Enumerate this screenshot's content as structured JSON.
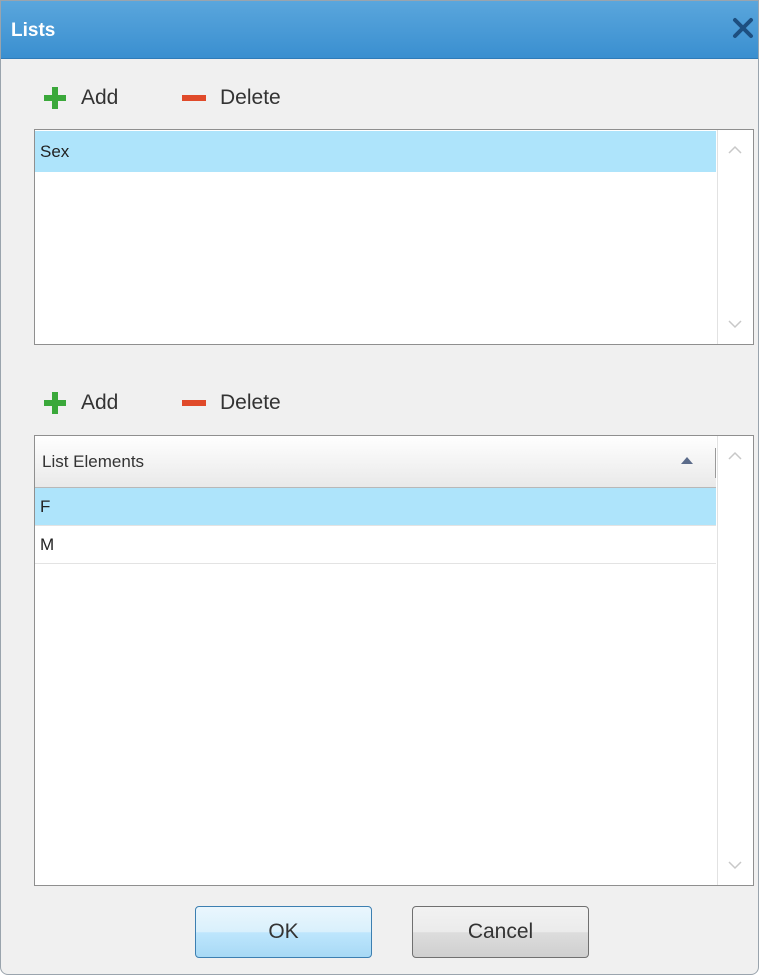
{
  "dialog": {
    "title": "Lists"
  },
  "lists_toolbar": {
    "add_label": "Add",
    "delete_label": "Delete"
  },
  "lists": {
    "items": [
      "Sex"
    ],
    "selected_index": 0
  },
  "elements_toolbar": {
    "add_label": "Add",
    "delete_label": "Delete"
  },
  "elements": {
    "column_header": "List Elements",
    "sort": "ascending",
    "rows": [
      "F",
      "M"
    ],
    "selected_index": 0
  },
  "buttons": {
    "ok_label": "OK",
    "cancel_label": "Cancel"
  },
  "colors": {
    "titlebar": "#3a8fd0",
    "selection": "#aee4fb",
    "add_icon": "#3aa83a",
    "delete_icon": "#e04a2a"
  },
  "icons": {
    "close": "close-icon",
    "add": "plus-icon",
    "delete": "minus-icon",
    "sort": "sort-ascending-icon"
  }
}
